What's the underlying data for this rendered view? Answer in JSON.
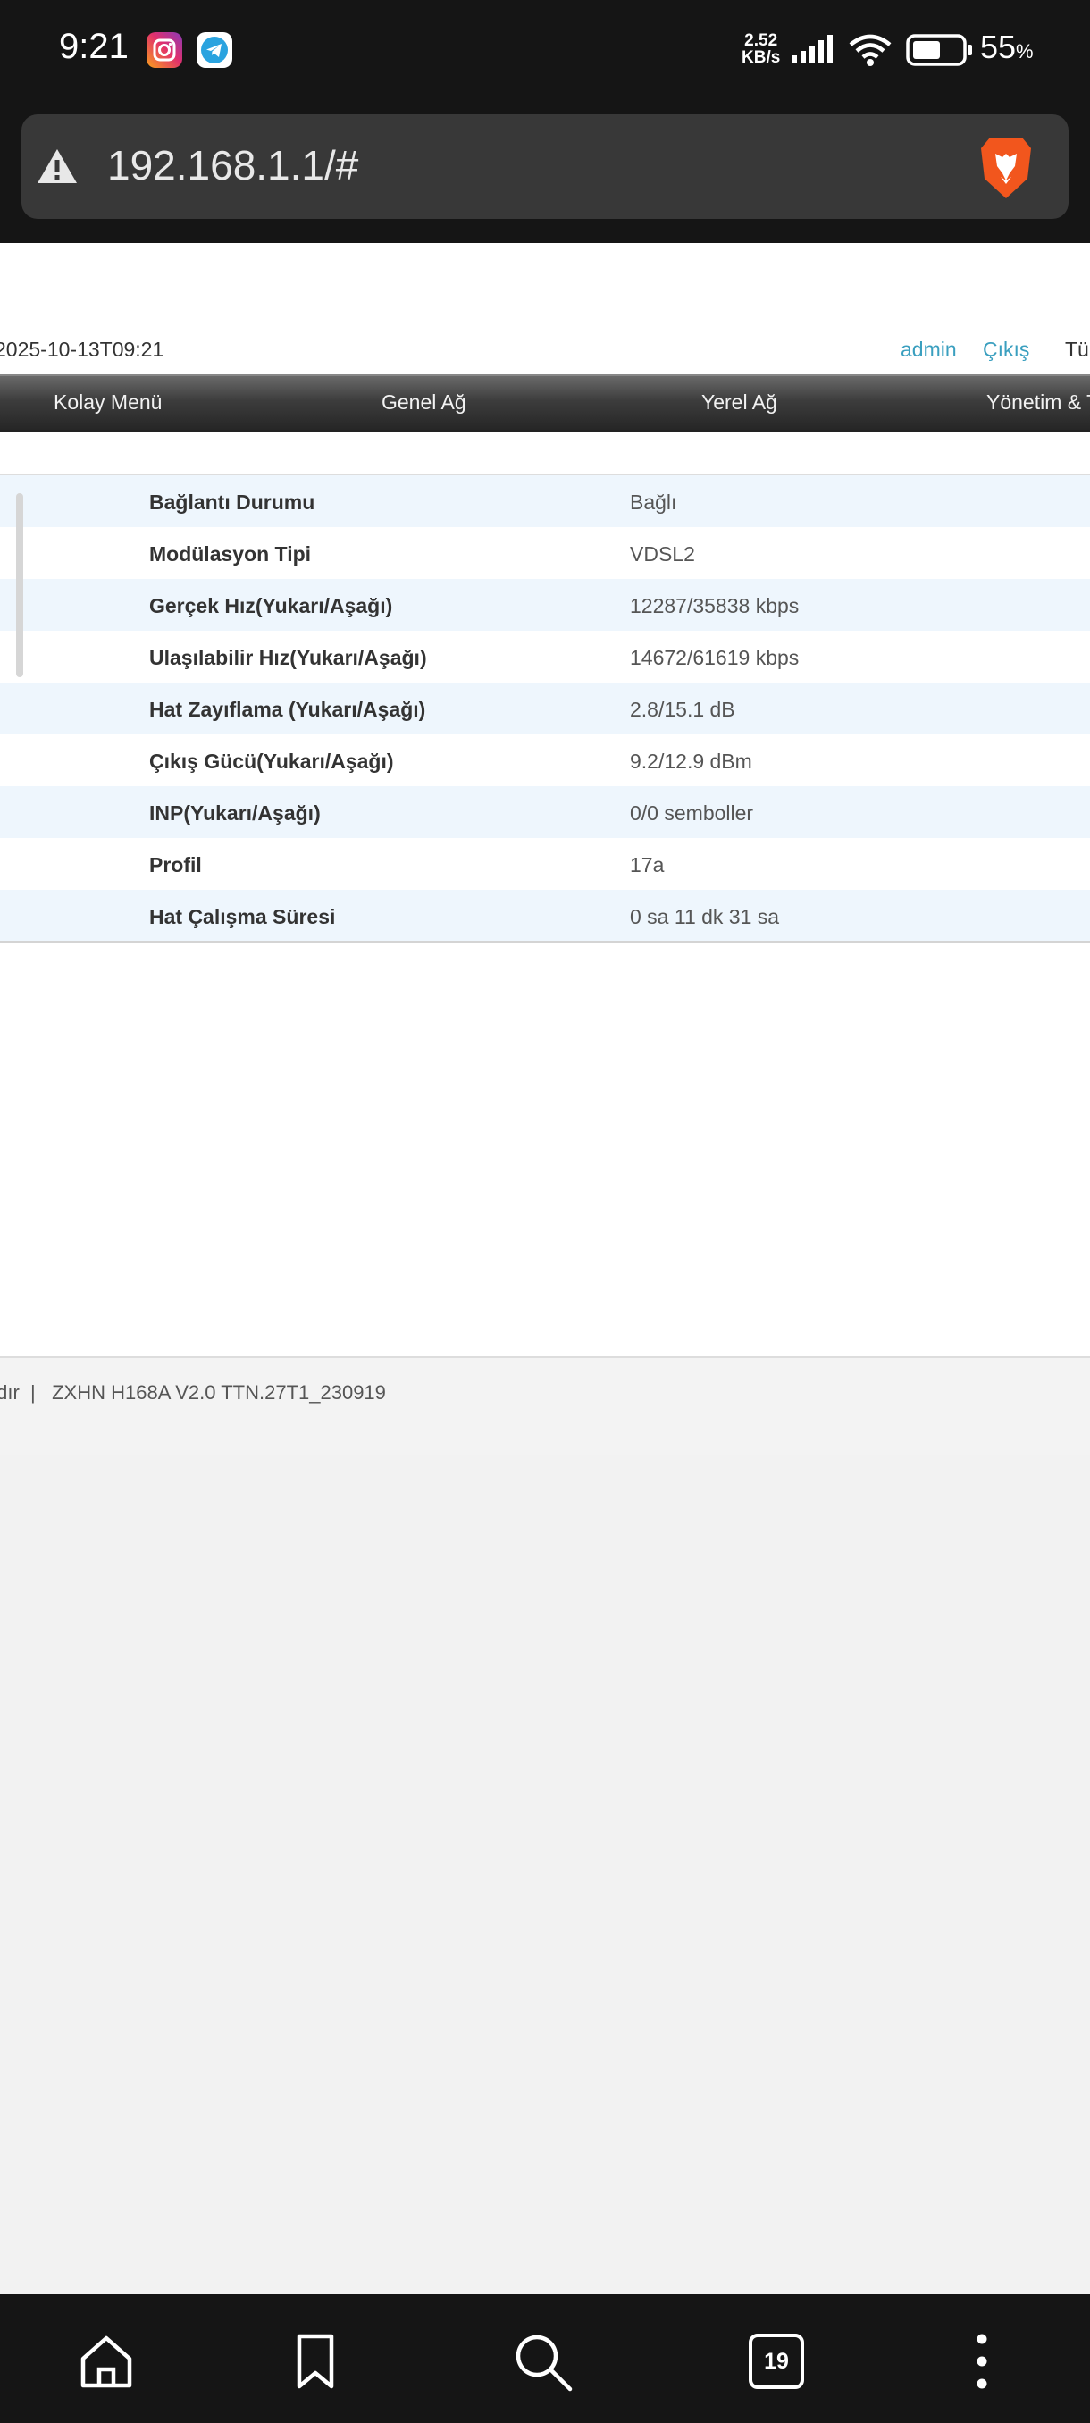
{
  "status_bar": {
    "time": "9:21",
    "net_speed_value": "2.52",
    "net_speed_unit": "KB/s",
    "battery_percent": "55",
    "battery_symbol": "%",
    "icons": [
      "instagram-icon",
      "telegram-icon",
      "signal-icon",
      "wifi-icon",
      "battery-icon"
    ]
  },
  "browser": {
    "url": "192.168.1.1/#",
    "tabs_count": "19",
    "bottom_icons": [
      "home-icon",
      "bookmark-icon",
      "search-icon",
      "tabs-icon",
      "more-icon"
    ]
  },
  "router": {
    "datetime": "2025-10-13T09:21",
    "user_link": "admin",
    "logout_link": "Çıkış",
    "language": "Tü",
    "nav": [
      "Kolay Menü",
      "Genel Ağ",
      "Yerel Ağ",
      "Yönetim & T"
    ],
    "status_rows": [
      {
        "label": "Bağlantı Durumu",
        "value": "Bağlı"
      },
      {
        "label": "Modülasyon Tipi",
        "value": "VDSL2"
      },
      {
        "label": "Gerçek Hız(Yukarı/Aşağı)",
        "value": "12287/35838 kbps"
      },
      {
        "label": "Ulaşılabilir Hız(Yukarı/Aşağı)",
        "value": "14672/61619 kbps"
      },
      {
        "label": "Hat Zayıflama (Yukarı/Aşağı)",
        "value": "2.8/15.1 dB"
      },
      {
        "label": "Çıkış Gücü(Yukarı/Aşağı)",
        "value": "9.2/12.9 dBm"
      },
      {
        "label": "INP(Yukarı/Aşağı)",
        "value": "0/0 semboller"
      },
      {
        "label": "Profil",
        "value": "17a"
      },
      {
        "label": "Hat Çalışma Süresi",
        "value": "0 sa 11 dk 31 sa"
      }
    ],
    "footer_fragment": "ıdır",
    "footer_separator": "|",
    "footer_version": "ZXHN H168A V2.0 TTN.27T1_230919"
  },
  "colors": {
    "link": "#3a9fbf",
    "row_alt": "#eef6fd",
    "brave_orange": "#f2561d"
  }
}
